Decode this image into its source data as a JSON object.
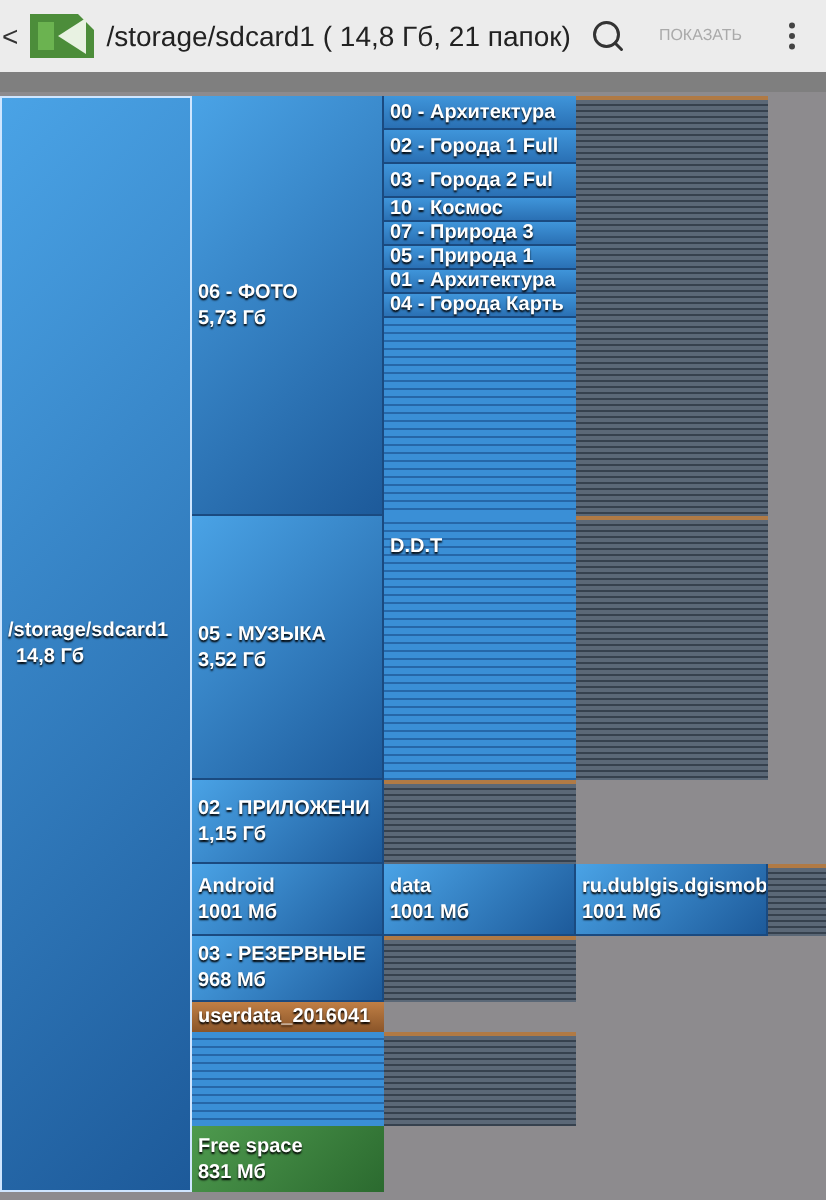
{
  "toolbar": {
    "back": "<",
    "title": "/storage/sdcard1 ( 14,8 Гб, 21 папок)",
    "action": "ПОКАЗАТЬ"
  },
  "root": {
    "name": "/storage/sdcard1",
    "size": "14,8 Гб"
  },
  "rows": [
    {
      "cells": [
        {
          "kind": "folder",
          "name": "06 - ФОТО",
          "size": "5,73 Гб"
        },
        {
          "kind": "list",
          "items": [
            "00 - Архитектура",
            "02 - Города 1 Full",
            "03 - Города 2 Ful",
            "10 - Космос",
            "07 - Природа 3",
            "05 - Природа 1",
            "01 - Архитектура",
            "04 - Города Карть"
          ]
        },
        {
          "kind": "files"
        }
      ]
    },
    {
      "cells": [
        {
          "kind": "folder",
          "name": "05 - МУЗЫКА",
          "size": "3,52 Гб"
        },
        {
          "kind": "dirs",
          "name": "D.D.T"
        },
        {
          "kind": "files"
        }
      ]
    },
    {
      "cells": [
        {
          "kind": "folder",
          "name": "02 - ПРИЛОЖЕНИ",
          "size": "1,15 Гб"
        },
        {
          "kind": "files"
        }
      ]
    },
    {
      "cells": [
        {
          "kind": "folder",
          "name": "Android",
          "size": "1001 Мб"
        },
        {
          "kind": "folder",
          "name": "data",
          "size": "1001 Мб"
        },
        {
          "kind": "folder",
          "name": "ru.dublgis.dgismob",
          "size": "1001 Мб"
        },
        {
          "kind": "files"
        }
      ]
    },
    {
      "cells": [
        {
          "kind": "folder",
          "name": "03 - РЕЗЕРВНЫЕ",
          "size": "968 Мб"
        },
        {
          "kind": "files"
        }
      ]
    },
    {
      "cells": [
        {
          "kind": "file",
          "name": "userdata_2016041"
        }
      ]
    },
    {
      "cells": [
        {
          "kind": "dirs"
        },
        {
          "kind": "files"
        }
      ]
    },
    {
      "cells": [
        {
          "kind": "free",
          "name": "Free space",
          "size": "831 Мб"
        }
      ]
    }
  ]
}
